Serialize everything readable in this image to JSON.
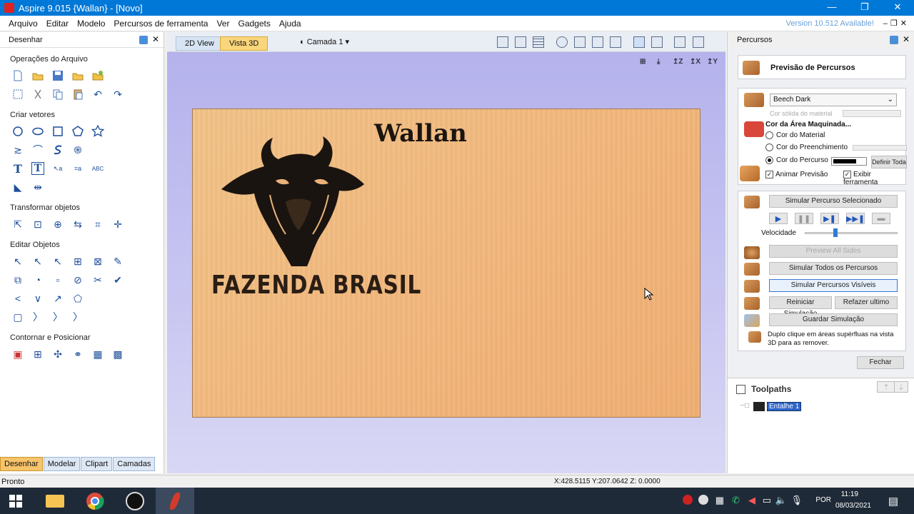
{
  "titlebar": {
    "title": "Aspire 9.015 {Wallan} - [Novo]",
    "min": "—",
    "max": "❐",
    "close": "✕"
  },
  "menu": {
    "items": [
      "Arquivo",
      "Editar",
      "Modelo",
      "Percursos de ferramenta",
      "Ver",
      "Gadgets",
      "Ajuda"
    ],
    "version_notice": "Version 10.512 Available!"
  },
  "left": {
    "header": "Desenhar",
    "sections": {
      "file_ops": "Operações do Arquivo",
      "create_vectors": "Criar vetores",
      "transform": "Transformar objetos",
      "edit": "Editar Objetos",
      "offset": "Contornar e Posicionar"
    },
    "tabs": [
      "Desenhar",
      "Modelar",
      "Clipart",
      "Camadas"
    ]
  },
  "view": {
    "tab_2d": "2D View",
    "tab_3d": "Vista 3D",
    "layer": "Camada 1",
    "board_title": "Wallan",
    "board_subtitle": "FAZENDA BRASIL"
  },
  "right": {
    "header": "Percursos",
    "preview_title": "Previsão de Percursos",
    "material": "Beech Dark",
    "solid_color_label": "Cor sólida do material",
    "machined_area": "Cor da Área Maquinada...",
    "radio_material": "Cor do Material",
    "radio_fill": "Cor do Preenchimento",
    "radio_path": "Cor do Percurso",
    "define_all": "Definir Toda",
    "animate": "Animar Previsão",
    "show_tool": "Exibir ferramenta",
    "sim_selected": "Simular Percurso Selecionado",
    "speed": "Velocidade",
    "preview_all_sides": "Preview All Sides",
    "sim_all": "Simular Todos os Percursos",
    "sim_visible": "Simular Percursos Visíveis",
    "reset_sim": "Reiniciar Simulação",
    "redo_last": "Refazer ultimo",
    "save_sim": "Guardar Simulação",
    "hint": "Duplo clique em áreas supérfluas na vista 3D para as remover.",
    "close": "Fechar",
    "toolpaths_label": "Toolpaths",
    "toolpath_item": "Entalhe 1"
  },
  "status": {
    "ready": "Pronto",
    "coords": "X:428.5115 Y:207.0642 Z: 0.0000"
  },
  "taskbar": {
    "lang": "POR",
    "time": "11:19",
    "date": "08/03/2021"
  }
}
